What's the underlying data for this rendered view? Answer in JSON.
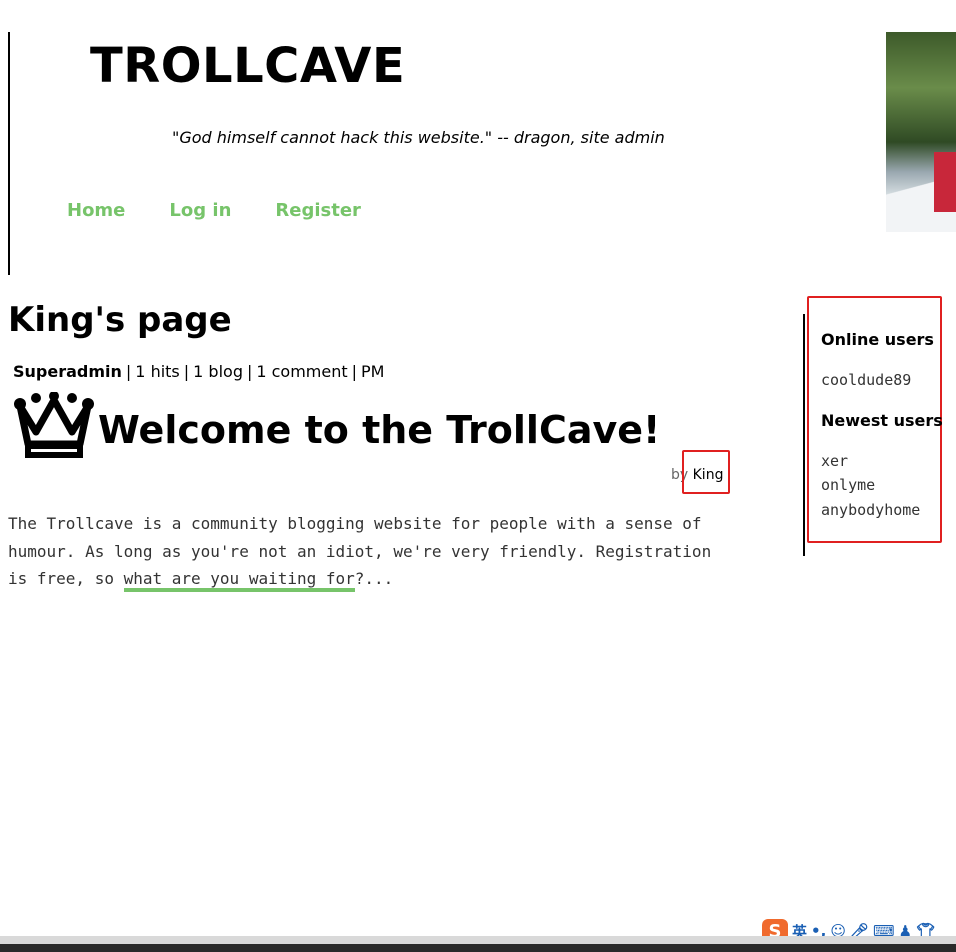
{
  "site": {
    "title": "TROLLCAVE",
    "tagline": "\"God himself cannot hack this website.\" -- dragon, site admin"
  },
  "nav": {
    "home": "Home",
    "login": "Log in",
    "register": "Register"
  },
  "colors": {
    "nav_link": "#77c46a",
    "highlight_box": "#e02020"
  },
  "profile": {
    "page_title": "King's page",
    "role": "Superadmin",
    "hits": "1 hits",
    "blogs": "1 blog",
    "comments": "1 comment",
    "pm": "PM"
  },
  "post": {
    "icon": "crown-icon",
    "title": "Welcome to the TrollCave!",
    "by_label": "by",
    "author": "King",
    "body_prefix": "The Trollcave is a community blogging website for people with a sense of humour. As long as you're not an idiot, we're very friendly. Registration is free, so ",
    "body_link": "what are you waiting for",
    "body_suffix": "?..."
  },
  "sidebar": {
    "online_heading": "Online users",
    "online_users": [
      "cooldude89"
    ],
    "newest_heading": "Newest users",
    "newest_users": [
      "xer",
      "onlyme",
      "anybodyhome"
    ]
  },
  "ime": {
    "logo": "S",
    "lang": "英",
    "punct": "•,"
  }
}
